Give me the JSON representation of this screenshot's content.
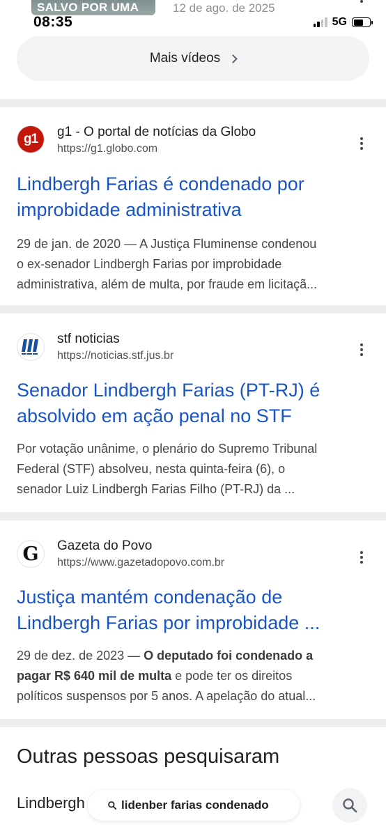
{
  "top": {
    "video_thumb_text": "SALVO POR UMA",
    "video_date": "12 de ago. de 2025",
    "clock": "08:35",
    "network": "5G"
  },
  "more_videos": {
    "label": "Mais vídeos"
  },
  "results": [
    {
      "site_name": "g1 - O portal de notícias da Globo",
      "url": "https://g1.globo.com",
      "favicon_text": "g1",
      "title_line1": "Lindbergh Farias é condenado por",
      "title_line2": "improbidade administrativa",
      "snippet_line1": "29 de jan. de 2020 — A Justiça Fluminense condenou",
      "snippet_line2": "o ex-senador Lindbergh Farias por improbidade",
      "snippet_line3": "administrativa, além de multa, por fraude em licitaçã..."
    },
    {
      "site_name": "stf noticias",
      "url": "https://noticias.stf.jus.br",
      "title_line1": "Senador Lindbergh Farias (PT-RJ) é",
      "title_line2": "absolvido em ação penal no STF",
      "snippet_line1": "Por votação unânime, o plenário do Supremo Tribunal",
      "snippet_line2": "Federal (STF) absolveu, nesta quinta-feira (6), o",
      "snippet_line3": "senador Luiz Lindbergh Farias Filho (PT-RJ) da ..."
    },
    {
      "site_name": "Gazeta do Povo",
      "url": "https://www.gazetadopovo.com.br",
      "favicon_text": "G",
      "title_line1": "Justiça mantém condenação de",
      "title_line2": "Lindbergh Farias por improbidade ...",
      "snippet_date": "29 de dez. de 2023 — ",
      "snippet_bold1": "O deputado foi condenado a",
      "snippet_bold2": "pagar R$ 640 mil de multa",
      "snippet_rest2": " e pode ter os direitos",
      "snippet_line3": "políticos suspensos por 5 anos. A apelação do atual..."
    }
  ],
  "others": {
    "title": "Outras pessoas pesquisaram",
    "first_item": "Lindbergh"
  },
  "search_pill": {
    "query": "lidenber farias condenado"
  },
  "colors": {
    "link": "#1a55c6",
    "separator": "#ecedef",
    "g1_red": "#c4170c",
    "stf_blue": "#1b4ea0"
  }
}
